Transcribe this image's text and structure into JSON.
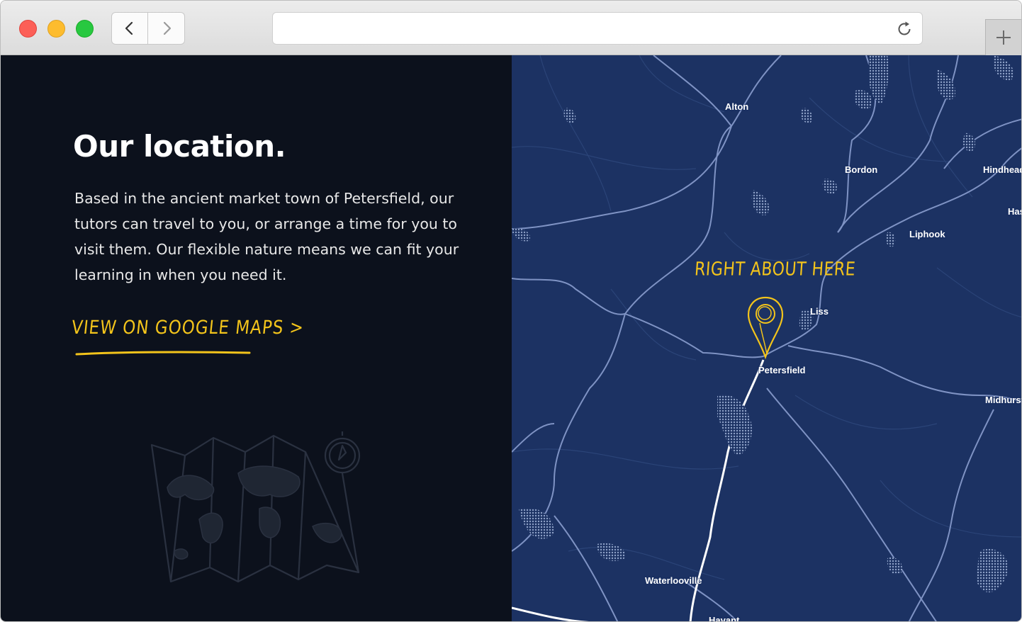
{
  "browser": {
    "colors": {
      "close": "#fc5f57",
      "minimize": "#fdbc2e",
      "maximize": "#28c840"
    },
    "icons": {
      "back": "chevron-left-icon",
      "forward": "chevron-right-icon",
      "reload": "reload-icon",
      "new_tab": "plus-icon"
    },
    "address_value": ""
  },
  "location": {
    "heading": "Our location.",
    "body": "Based in the ancient market town of Petersfield, our tutors can travel to you, or arrange a time for you to visit them. Our flexible nature means we can fit your learning in when you need it.",
    "link_label": "VIEW ON GOOGLE MAPS >",
    "accent_color": "#f3c41b",
    "background_color": "#0c111c"
  },
  "map": {
    "background_color": "#1c3263",
    "marker_label": "RIGHT ABOUT HERE",
    "towns": {
      "alton": "Alton",
      "bordon": "Bordon",
      "hindhead": "Hindhead",
      "haslemere": "Has",
      "liphook": "Liphook",
      "liss": "Liss",
      "petersfield": "Petersfield",
      "midhurst": "Midhurst",
      "waterlooville": "Waterlooville",
      "havant": "Havant"
    }
  }
}
